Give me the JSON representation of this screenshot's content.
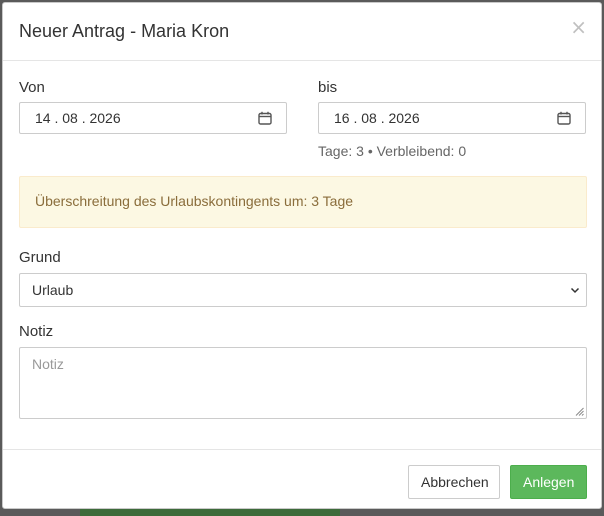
{
  "modal": {
    "title": "Neuer Antrag - Maria Kron",
    "close_label": "×"
  },
  "from": {
    "label": "Von",
    "value": "14 . 08 . 2026"
  },
  "to": {
    "label": "bis",
    "value": "16 . 08 . 2026"
  },
  "summary": "Tage: 3 • Verbleibend: 0",
  "warning": "Überschreitung des Urlaubskontingents um: 3 Tage",
  "reason": {
    "label": "Grund",
    "selected": "Urlaub"
  },
  "note": {
    "label": "Notiz",
    "placeholder": "Notiz",
    "value": ""
  },
  "footer": {
    "cancel_label": "Abbrechen",
    "submit_label": "Anlegen"
  },
  "colors": {
    "warning_bg": "#fcf8e3",
    "warning_text": "#8a6d3b",
    "submit_bg": "#5cb85c"
  },
  "icons": {
    "date": "calendar-icon",
    "select": "chevron-down-icon",
    "textarea": "resize-grip-icon",
    "close": "close-icon"
  }
}
